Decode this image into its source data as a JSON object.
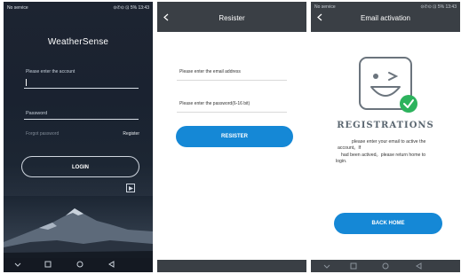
{
  "login_screen": {
    "status_left": "No service",
    "status_right": "⊙✆⊙ ⊡ 5% 13:43",
    "app_logo": "WeatherSense",
    "account_placeholder": "Please enter the account",
    "password_placeholder": "Password",
    "forgot_password": "Forgot password",
    "register_link": "Register",
    "login_label": "LOGIN",
    "nav_icons": [
      "chevron-down-icon",
      "square-icon",
      "circle-icon",
      "triangle-back-icon"
    ]
  },
  "register_screen": {
    "title": "Resister",
    "email_placeholder": "Please enter the email address",
    "password_placeholder": "Please enter the password(6-16 bit)",
    "register_button": "RESISTER"
  },
  "activation_screen": {
    "status_left": "No service",
    "status_right": "⊙✆⊙ ⊡ 5% 13:43",
    "title": "Email activation",
    "illustration_title": "REGISTRATIONS",
    "message_line1": "please enter your email to active the",
    "message_line2": "account。If",
    "message_line3": "had been actived。please return home to",
    "message_line4": "login.",
    "back_home_button": "BACK HOME"
  },
  "colors": {
    "accent_blue": "#1588d6",
    "titlebar_gray": "#3a3f45",
    "check_green": "#2db35d",
    "login_bg": "#1d2431"
  }
}
